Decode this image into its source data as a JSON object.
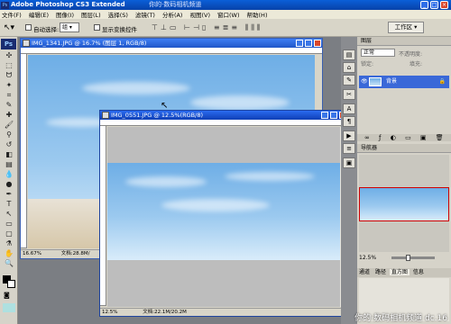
{
  "app": {
    "title": "Adobe Photoshop CS3 Extended",
    "logo": "Ps",
    "overlay_text": "你的·数码相机频道"
  },
  "menu": [
    "文件(F)",
    "编辑(E)",
    "图像(I)",
    "图层(L)",
    "选择(S)",
    "滤镜(T)",
    "分析(A)",
    "视图(V)",
    "窗口(W)",
    "帮助(H)"
  ],
  "options_bar": {
    "auto_select_label": "自动选择:",
    "auto_select_value": "组",
    "show_transform_label": "显示变换控件",
    "workspace_label": "工作区 ▾"
  },
  "documents": [
    {
      "title": "IMG_1341.JPG @ 16.7% (图层 1, RGB/8)",
      "zoom": "16.67%",
      "status": "文档:28.8M/"
    },
    {
      "title": "IMG_0551.JPG @ 12.5%(RGB/8)",
      "zoom": "12.5%",
      "status": "文档:22.1M/20.2M"
    }
  ],
  "layers_panel": {
    "tab": "图层",
    "blend_mode": "正常",
    "opacity_label": "不透明度:",
    "lock_label": "锁定:",
    "fill_label": "填充:",
    "layer_name": "背景"
  },
  "navigator_panel": {
    "tab": "导航器",
    "zoom": "12.5%"
  },
  "bottom_tabs": [
    "通道",
    "路径",
    "直方图",
    "信息"
  ],
  "watermark": "你的·数码相机频道 dc.16"
}
